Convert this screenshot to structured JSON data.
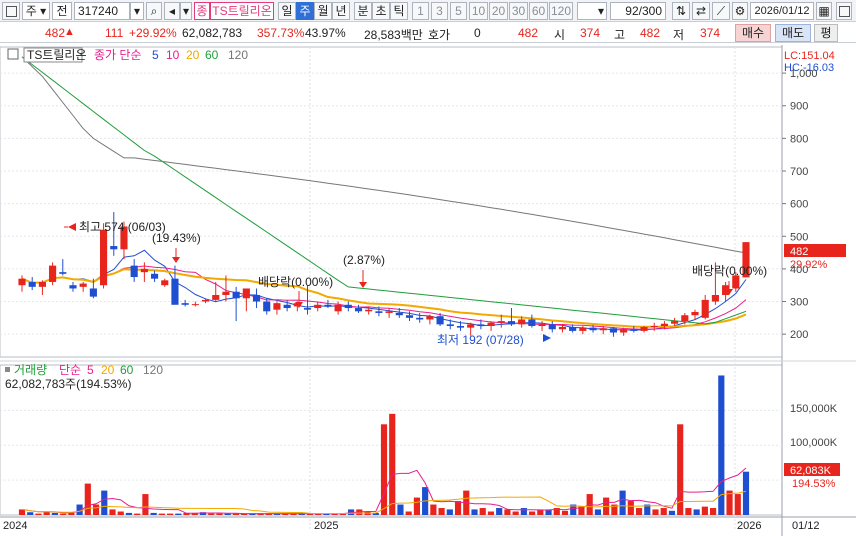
{
  "toolbar": {
    "market": "주",
    "prev": "전",
    "code": "317240",
    "badge": "종",
    "name": "TS트릴리온",
    "periods": [
      "일",
      "주",
      "월",
      "년",
      "분",
      "초",
      "틱"
    ],
    "active_period": "주",
    "intervals": [
      "1",
      "3",
      "5",
      "10",
      "20",
      "30",
      "60",
      "120"
    ],
    "counter": "92/300",
    "date": "2026/01/12"
  },
  "quote": {
    "price": "482",
    "change": "111",
    "change_pct": "+29.92%",
    "volume": "62,082,783",
    "volume_pct": "357.73%",
    "turnover_pct": "43.97%",
    "amount": "28,583백만",
    "ask_label": "호가",
    "ask_value": "0",
    "ask_price": "482",
    "open_label": "시",
    "open": "374",
    "high_label": "고",
    "high": "482",
    "low_label": "저",
    "low": "374",
    "buy": "매수",
    "sell": "매도",
    "flat": "평"
  },
  "price_panel": {
    "title": "TS트릴리온",
    "ma_label": "종가 단순",
    "ma_periods": [
      "5",
      "10",
      "20",
      "60",
      "120"
    ],
    "ma_colors": [
      "#1f4fd1",
      "#e91e8c",
      "#f2a900",
      "#1e9e3a",
      "#777777"
    ],
    "lc": "LC:151.04",
    "hc": "HC:-16.03",
    "ticks": [
      "1,000",
      "900",
      "800",
      "700",
      "600",
      "500",
      "400",
      "300",
      "200"
    ],
    "last_price": "482",
    "last_pct": "29.92%",
    "annotations": {
      "high": "최고 574 (06/03)",
      "pct1": "(19.43%)",
      "div1": "배당락(0.00%)",
      "pct2": "(2.87%)",
      "low": "최저 192 (07/28)",
      "div2": "배당락(0.00%)"
    }
  },
  "volume_panel": {
    "title": "거래량",
    "ma_label": "단순",
    "ma_periods": [
      "5",
      "20",
      "60",
      "120"
    ],
    "ma_colors": [
      "#e91e8c",
      "#f2a900",
      "#1e9e3a",
      "#777777"
    ],
    "current": "62,082,783주(194.53%)",
    "ticks": [
      "150,000K",
      "100,000K"
    ],
    "last_value": "62,083K",
    "last_pct": "194.53%"
  },
  "x_axis": [
    "2024",
    "2025",
    "2026",
    "01/12"
  ],
  "chart_data": {
    "type": "candlestick",
    "ylim": [
      130,
      1080
    ],
    "volume_ylim": [
      0,
      215000
    ],
    "candles": [
      {
        "o": 350,
        "h": 380,
        "l": 330,
        "c": 370
      },
      {
        "o": 360,
        "h": 375,
        "l": 335,
        "c": 345
      },
      {
        "o": 345,
        "h": 365,
        "l": 320,
        "c": 360
      },
      {
        "o": 360,
        "h": 420,
        "l": 350,
        "c": 410
      },
      {
        "o": 390,
        "h": 430,
        "l": 380,
        "c": 385
      },
      {
        "o": 350,
        "h": 360,
        "l": 330,
        "c": 340
      },
      {
        "o": 345,
        "h": 360,
        "l": 330,
        "c": 355
      },
      {
        "o": 340,
        "h": 370,
        "l": 310,
        "c": 315
      },
      {
        "o": 350,
        "h": 540,
        "l": 340,
        "c": 520
      },
      {
        "o": 470,
        "h": 574,
        "l": 440,
        "c": 460
      },
      {
        "o": 460,
        "h": 545,
        "l": 430,
        "c": 530
      },
      {
        "o": 410,
        "h": 430,
        "l": 360,
        "c": 375
      },
      {
        "o": 390,
        "h": 420,
        "l": 360,
        "c": 400
      },
      {
        "o": 385,
        "h": 395,
        "l": 360,
        "c": 370
      },
      {
        "o": 350,
        "h": 370,
        "l": 345,
        "c": 365
      },
      {
        "o": 370,
        "h": 410,
        "l": 320,
        "c": 290
      },
      {
        "o": 295,
        "h": 305,
        "l": 285,
        "c": 290
      },
      {
        "o": 290,
        "h": 300,
        "l": 285,
        "c": 292
      },
      {
        "o": 300,
        "h": 310,
        "l": 295,
        "c": 305
      },
      {
        "o": 305,
        "h": 360,
        "l": 300,
        "c": 320
      },
      {
        "o": 320,
        "h": 380,
        "l": 300,
        "c": 330
      },
      {
        "o": 330,
        "h": 345,
        "l": 240,
        "c": 310
      },
      {
        "o": 310,
        "h": 330,
        "l": 270,
        "c": 340
      },
      {
        "o": 320,
        "h": 340,
        "l": 280,
        "c": 300
      },
      {
        "o": 300,
        "h": 310,
        "l": 260,
        "c": 270
      },
      {
        "o": 275,
        "h": 300,
        "l": 260,
        "c": 295
      },
      {
        "o": 290,
        "h": 305,
        "l": 270,
        "c": 280
      },
      {
        "o": 285,
        "h": 300,
        "l": 270,
        "c": 295
      },
      {
        "o": 280,
        "h": 350,
        "l": 260,
        "c": 275
      },
      {
        "o": 280,
        "h": 300,
        "l": 270,
        "c": 290
      },
      {
        "o": 290,
        "h": 305,
        "l": 280,
        "c": 285
      },
      {
        "o": 270,
        "h": 300,
        "l": 260,
        "c": 290
      },
      {
        "o": 290,
        "h": 300,
        "l": 270,
        "c": 280
      },
      {
        "o": 280,
        "h": 290,
        "l": 265,
        "c": 270
      },
      {
        "o": 270,
        "h": 285,
        "l": 260,
        "c": 275
      },
      {
        "o": 270,
        "h": 285,
        "l": 255,
        "c": 265
      },
      {
        "o": 265,
        "h": 280,
        "l": 250,
        "c": 270
      },
      {
        "o": 265,
        "h": 280,
        "l": 250,
        "c": 258
      },
      {
        "o": 258,
        "h": 270,
        "l": 240,
        "c": 250
      },
      {
        "o": 250,
        "h": 265,
        "l": 235,
        "c": 245
      },
      {
        "o": 245,
        "h": 260,
        "l": 230,
        "c": 255
      },
      {
        "o": 255,
        "h": 265,
        "l": 225,
        "c": 230
      },
      {
        "o": 230,
        "h": 245,
        "l": 215,
        "c": 225
      },
      {
        "o": 225,
        "h": 240,
        "l": 210,
        "c": 220
      },
      {
        "o": 220,
        "h": 235,
        "l": 195,
        "c": 230
      },
      {
        "o": 230,
        "h": 245,
        "l": 215,
        "c": 225
      },
      {
        "o": 225,
        "h": 240,
        "l": 210,
        "c": 235
      },
      {
        "o": 235,
        "h": 260,
        "l": 220,
        "c": 240
      },
      {
        "o": 240,
        "h": 280,
        "l": 225,
        "c": 230
      },
      {
        "o": 230,
        "h": 255,
        "l": 220,
        "c": 245
      },
      {
        "o": 245,
        "h": 260,
        "l": 220,
        "c": 225
      },
      {
        "o": 225,
        "h": 240,
        "l": 210,
        "c": 230
      },
      {
        "o": 230,
        "h": 240,
        "l": 205,
        "c": 215
      },
      {
        "o": 215,
        "h": 230,
        "l": 205,
        "c": 222
      },
      {
        "o": 222,
        "h": 230,
        "l": 205,
        "c": 210
      },
      {
        "o": 210,
        "h": 225,
        "l": 200,
        "c": 220
      },
      {
        "o": 220,
        "h": 228,
        "l": 205,
        "c": 212
      },
      {
        "o": 212,
        "h": 225,
        "l": 200,
        "c": 218
      },
      {
        "o": 218,
        "h": 222,
        "l": 192,
        "c": 205
      },
      {
        "o": 205,
        "h": 220,
        "l": 195,
        "c": 215
      },
      {
        "o": 215,
        "h": 225,
        "l": 205,
        "c": 210
      },
      {
        "o": 210,
        "h": 225,
        "l": 205,
        "c": 222
      },
      {
        "o": 222,
        "h": 235,
        "l": 210,
        "c": 225
      },
      {
        "o": 225,
        "h": 240,
        "l": 215,
        "c": 232
      },
      {
        "o": 232,
        "h": 250,
        "l": 225,
        "c": 240
      },
      {
        "o": 240,
        "h": 265,
        "l": 230,
        "c": 258
      },
      {
        "o": 258,
        "h": 275,
        "l": 245,
        "c": 268
      },
      {
        "o": 250,
        "h": 320,
        "l": 245,
        "c": 305
      },
      {
        "o": 300,
        "h": 420,
        "l": 290,
        "c": 320
      },
      {
        "o": 320,
        "h": 360,
        "l": 300,
        "c": 350
      },
      {
        "o": 340,
        "h": 390,
        "l": 330,
        "c": 380
      },
      {
        "o": 374,
        "h": 482,
        "l": 374,
        "c": 482
      }
    ],
    "volumes": [
      8000,
      4000,
      2000,
      5000,
      3000,
      2000,
      3000,
      15000,
      45000,
      15000,
      35000,
      8000,
      5000,
      3000,
      2000,
      30000,
      3000,
      2000,
      2000,
      2000,
      3000,
      3000,
      4000,
      2000,
      2000,
      2000,
      2000,
      2000,
      2000,
      2000,
      2000,
      2000,
      2000,
      2000,
      2000,
      2000,
      2000,
      2000,
      2000,
      2000,
      8000,
      8000,
      5000,
      3000,
      130000,
      145000,
      15000,
      5000,
      25000,
      40000,
      15000,
      10000,
      8000,
      20000,
      35000,
      8000,
      10000,
      5000,
      10000,
      8000,
      5000,
      10000,
      5000,
      8000,
      8000,
      10000,
      6000,
      15000,
      12000,
      30000,
      8000,
      25000,
      15000,
      35000,
      20000,
      10000,
      15000,
      8000,
      10000,
      6000,
      130000,
      10000,
      8000,
      12000,
      10000,
      200000,
      35000,
      30000,
      62083
    ]
  }
}
